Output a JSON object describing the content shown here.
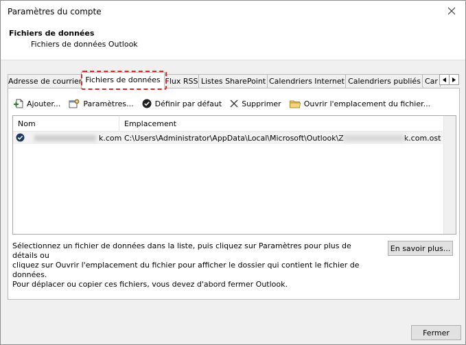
{
  "window": {
    "title": "Paramètres du compte"
  },
  "header": {
    "title": "Fichiers de données",
    "subtitle": "Fichiers de données Outlook"
  },
  "tabs": [
    {
      "label": "Adresse de courrier",
      "active": false
    },
    {
      "label": "Fichiers de données",
      "active": true
    },
    {
      "label": "Flux RSS",
      "active": false
    },
    {
      "label": "Listes SharePoint",
      "active": false
    },
    {
      "label": "Calendriers Internet",
      "active": false
    },
    {
      "label": "Calendriers publiés",
      "active": false
    },
    {
      "label": "Car",
      "active": false
    }
  ],
  "toolbar": {
    "add_label": "Ajouter...",
    "settings_label": "Paramètres...",
    "default_label": "Définir par défaut",
    "remove_label": "Supprimer",
    "open_location_label": "Ouvrir l'emplacement du fichier..."
  },
  "list": {
    "columns": [
      "Nom",
      "Emplacement"
    ],
    "rows": [
      {
        "name_visible": "k.com",
        "location_visible": "C:\\Users\\Administrator\\AppData\\Local\\Microsoft\\Outlook\\Z",
        "location_suffix": "k.com.ost"
      }
    ]
  },
  "description": {
    "line1": "Sélectionnez un fichier de données dans la liste, puis cliquez sur Paramètres pour plus de détails ou",
    "line2": "cliquez sur Ouvrir l'emplacement du fichier pour afficher le dossier qui contient le fichier de données.",
    "line3": "Pour déplacer ou copier ces fichiers, vous devez d'abord fermer Outlook."
  },
  "buttons": {
    "learn_more": "En savoir plus...",
    "close": "Fermer"
  },
  "colors": {
    "highlight": "#e02424",
    "selected_row": "#f2f2f2"
  }
}
